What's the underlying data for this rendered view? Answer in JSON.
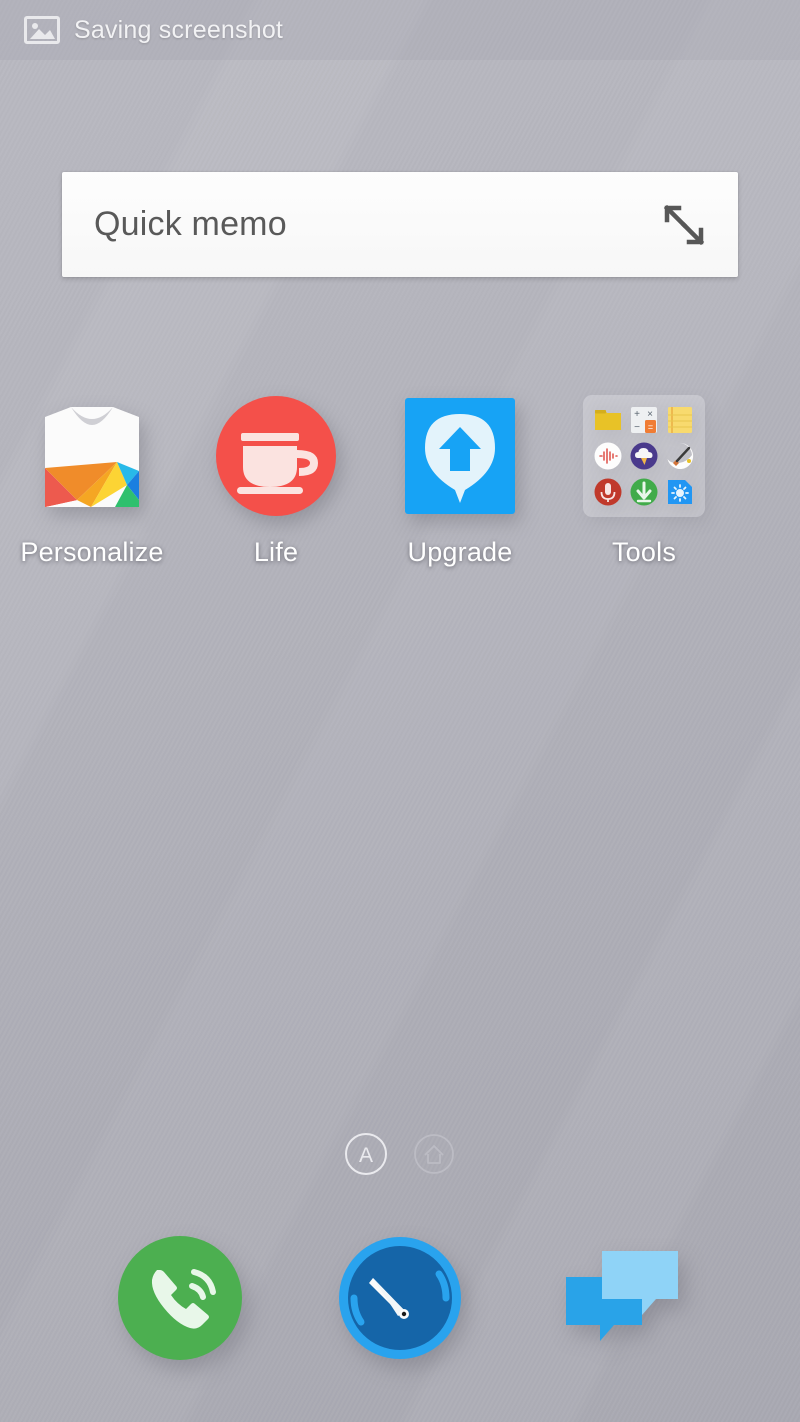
{
  "status_bar": {
    "icon": "image-icon",
    "text": "Saving screenshot"
  },
  "widget": {
    "name": "quick-memo-widget",
    "label": "Quick memo",
    "expand_icon": "expand-diagonal-icon"
  },
  "apps": [
    {
      "label": "Personalize",
      "icon": "tshirt-icon"
    },
    {
      "label": "Life",
      "icon": "coffee-cup-icon"
    },
    {
      "label": "Upgrade",
      "icon": "upgrade-arrow-pin-icon"
    },
    {
      "label": "Tools",
      "icon": "folder-preview-icon"
    }
  ],
  "tools_folder": {
    "items": [
      {
        "icon": "file-manager-folder-icon"
      },
      {
        "icon": "calculator-icon"
      },
      {
        "icon": "notepad-icon"
      },
      {
        "icon": "sound-recorder-waveform-icon"
      },
      {
        "icon": "weather-cloud-icon"
      },
      {
        "icon": "paintbrush-icon"
      },
      {
        "icon": "voice-microphone-icon"
      },
      {
        "icon": "download-arrow-icon"
      },
      {
        "icon": "brightness-sun-file-icon"
      }
    ]
  },
  "page_indicator": {
    "pages": [
      {
        "icon": "letter-a-circle-icon",
        "active": true
      },
      {
        "icon": "home-circle-icon",
        "active": false
      }
    ]
  },
  "dock": [
    {
      "icon": "phone-icon",
      "label": "Phone"
    },
    {
      "icon": "browser-compass-icon",
      "label": "Browser"
    },
    {
      "icon": "messaging-bubbles-icon",
      "label": "Messaging"
    }
  ],
  "colors": {
    "wallpaper_top": "#b9b9c1",
    "wallpaper_bottom": "#a9a9b2",
    "widget_bg": "#fafafa",
    "widget_text": "#595959",
    "label_text": "#ffffff",
    "life_red": "#f4504a",
    "upgrade_blue": "#17a3f5",
    "phone_green": "#4caf50",
    "compass_blue": "#1565a8",
    "compass_ring": "#29a3ee",
    "message_light": "#8fd3f7",
    "message_dark": "#29a3e8"
  }
}
